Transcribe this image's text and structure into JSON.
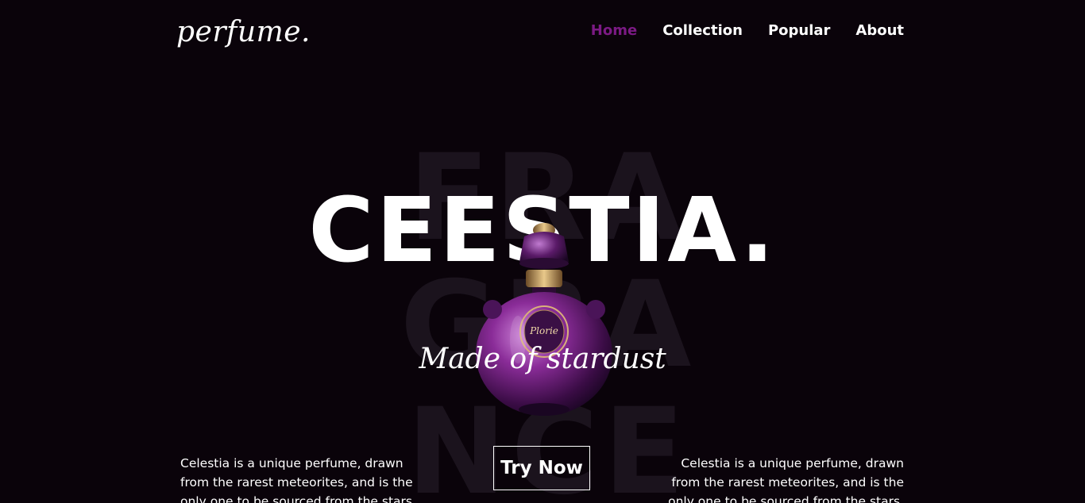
{
  "nav": {
    "logo": "perfume.",
    "items": [
      {
        "label": "Home",
        "active": true
      },
      {
        "label": "Collection",
        "active": false
      },
      {
        "label": "Popular",
        "active": false
      },
      {
        "label": "About",
        "active": false
      }
    ]
  },
  "hero": {
    "watermark_lines": [
      "FRA",
      "GRA",
      "NCE"
    ],
    "title": "CEESTIA.",
    "subtitle": "Made of stardust",
    "bottle_label": "Plorie",
    "description_left": "Celestia is a unique perfume, drawn from the rarest meteorites, and is the only one to be sourced from the stars.",
    "description_right": "Celestia is a unique perfume, drawn from the rarest meteorites, and is the only one to be sourced from the stars.",
    "cta_label": "Try Now"
  },
  "colors": {
    "background": "#0a030a",
    "accent": "#7b1a84",
    "watermark": "#1b131d",
    "text": "#ffffff"
  }
}
